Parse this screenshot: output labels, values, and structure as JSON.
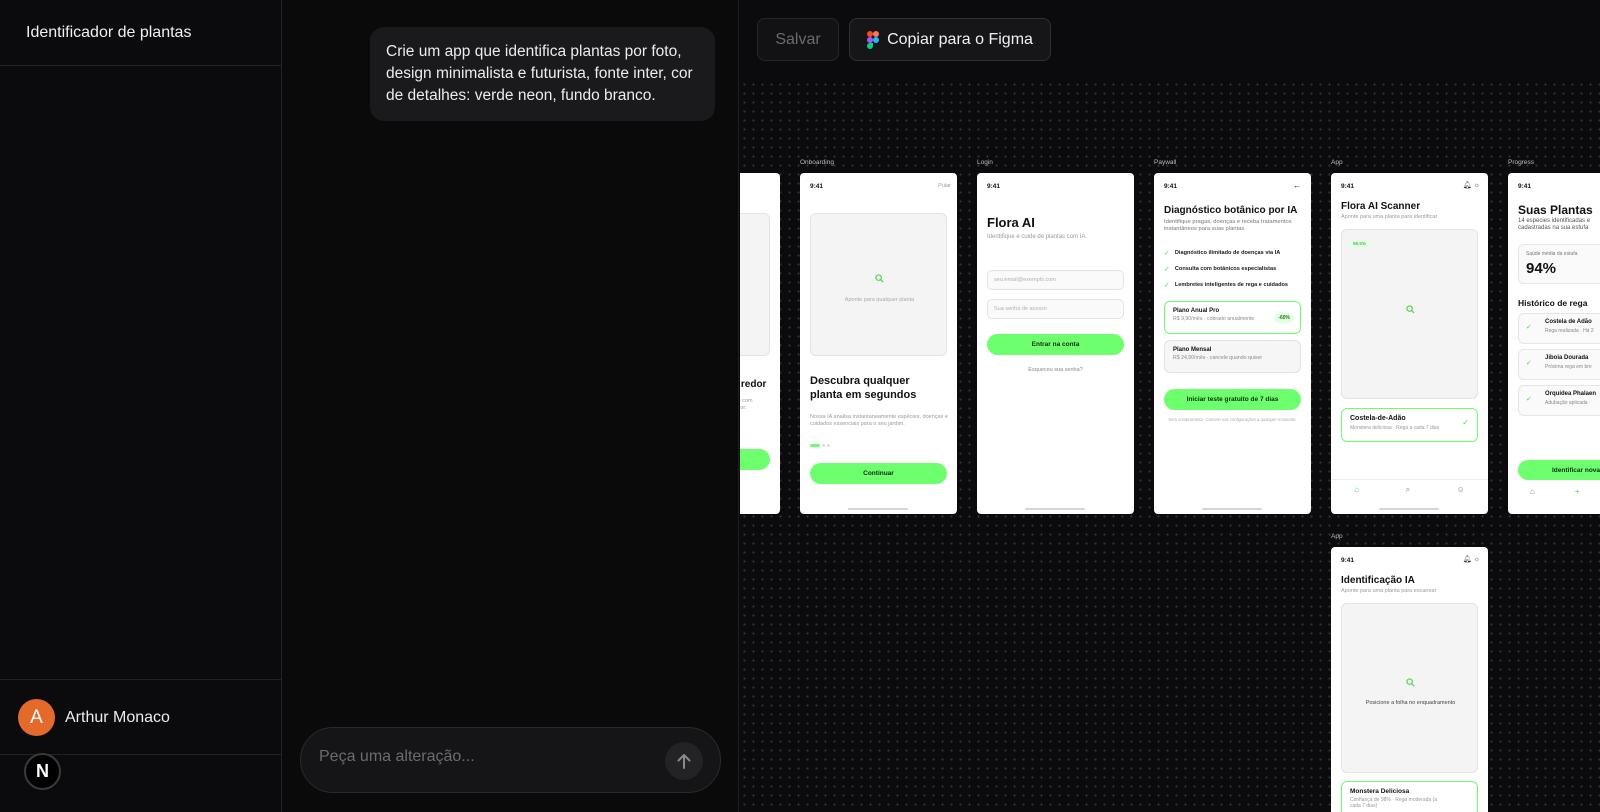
{
  "sidebar": {
    "project_title": "Identificador de plantas",
    "user": {
      "initial": "A",
      "name": "Arthur Monaco"
    },
    "badge": "N"
  },
  "chat": {
    "prompt_message": "Crie um app que identifica plantas por foto, design minimalista e futurista, fonte inter, cor de detalhes: verde neon, fundo branco.",
    "input_placeholder": "Peça uma alteração..."
  },
  "toolbar": {
    "save_label": "Salvar",
    "figma_label": "Copiar para o Figma"
  },
  "colors": {
    "accent": "#6dff6d",
    "canvas_bg": "#0b0b0d",
    "avatar": "#e46a2c"
  },
  "frames": {
    "clip": {
      "heading": "u redor",
      "sub": "nte com\nelhor."
    },
    "onboarding": {
      "label": "Onboarding",
      "time": "9:41",
      "skip": "Pular",
      "image_hint": "Aponte para qualquer planta",
      "title": "Descubra qualquer planta em segundos",
      "desc": "Nossa IA analisa instantaneamente espécies, doenças e cuidados essenciais para o seu jardim.",
      "cta": "Continuar"
    },
    "login": {
      "label": "Login",
      "time": "9:41",
      "title": "Flora AI",
      "subtitle": "Identifique e cuide de plantas com IA.",
      "email_placeholder": "seu.email@exemplo.com",
      "password_placeholder": "Sua senha de acesso",
      "cta": "Entrar na conta",
      "forgot": "Esqueceu sua senha?"
    },
    "paywall": {
      "label": "Paywall",
      "time": "9:41",
      "title": "Diagnóstico botânico por IA",
      "subtitle": "Identifique pragas, doenças e receba tratamentos instantâneos para suas plantas.",
      "features": [
        "Diagnóstico ilimitado de doenças via IA",
        "Consulta com botânicos especialistas",
        "Lembretes inteligentes de rega e cuidados"
      ],
      "plan_annual": {
        "name": "Plano Anual Pro",
        "price": "R$ 9,90/mês · cobrado anualmente",
        "badge": "-60%"
      },
      "plan_monthly": {
        "name": "Plano Mensal",
        "price": "R$ 24,90/mês · cancele quando quiser"
      },
      "cta": "Iniciar teste gratuito de 7 dias",
      "note": "Sem compromisso. Cancele nas configurações a qualquer momento."
    },
    "scanner": {
      "label": "App",
      "time": "9:41",
      "title": "Flora AI Scanner",
      "subtitle": "Aponte para uma planta para identificar",
      "tag": "98,6%",
      "result_name": "Costela-de-Adão",
      "result_detail": "Monstera deliciosa · Rega a cada 7 dias"
    },
    "progress": {
      "label": "Progress",
      "time": "9:41",
      "title": "Suas Plantas",
      "subtitle": "14 espécies identificadas e cadastradas na sua estufa",
      "health_label": "Saúde média da estufa",
      "health_value": "94%",
      "history_title": "Histórico de rega",
      "history": [
        {
          "name": "Costela de Adão",
          "detail": "Rega realizada · Há 2"
        },
        {
          "name": "Jiboia Dourada",
          "detail": "Próxima rega em bre"
        },
        {
          "name": "Orquídea Phalaen",
          "detail": "Adubação aplicada ·"
        }
      ],
      "cta": "Identificar nova"
    },
    "identify": {
      "label": "App",
      "time": "9:41",
      "title": "Identificação IA",
      "subtitle": "Aponte para uma planta para escanear",
      "image_hint": "Posicione a folha no enquadramento",
      "result_name": "Monstera Deliciosa",
      "result_detail": "Confiança de 98% · Rega moderada (a cada 7 dias)"
    }
  }
}
